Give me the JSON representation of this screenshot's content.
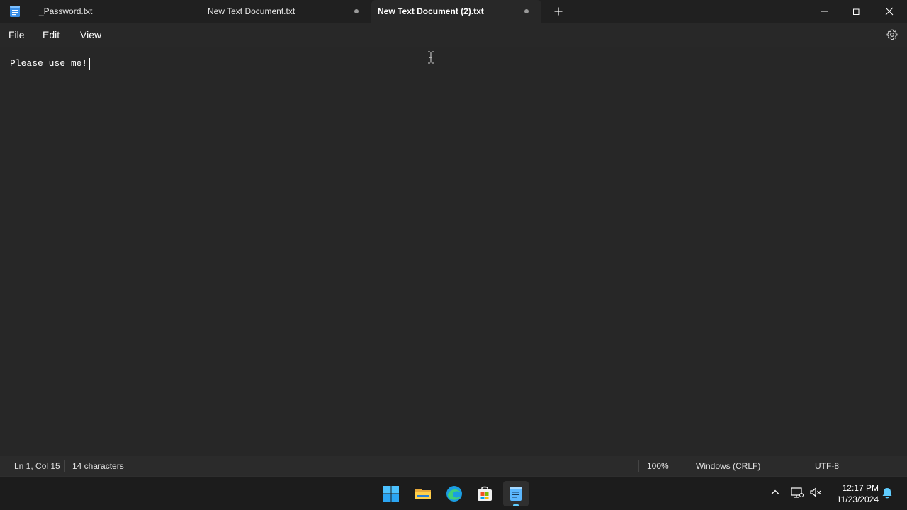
{
  "window": {
    "tabs": [
      {
        "label": "_Password.txt",
        "modified": false
      },
      {
        "label": "New Text Document.txt",
        "modified": true
      },
      {
        "label": "New Text Document (2).txt",
        "modified": true,
        "active": true
      }
    ]
  },
  "menu": {
    "file": "File",
    "edit": "Edit",
    "view": "View"
  },
  "editor": {
    "content": "Please use me!"
  },
  "status": {
    "position": "Ln 1, Col 15",
    "characters": "14 characters",
    "zoom": "100%",
    "line_ending": "Windows (CRLF)",
    "encoding": "UTF-8"
  },
  "taskbar": {
    "apps": [
      "start-icon",
      "file-explorer-icon",
      "edge-icon",
      "store-icon",
      "notepad-icon"
    ],
    "time": "12:17 PM",
    "date": "11/23/2024"
  },
  "colors": {
    "accent": "#60cdff",
    "background": "#202020",
    "editor_bg": "#272727"
  }
}
